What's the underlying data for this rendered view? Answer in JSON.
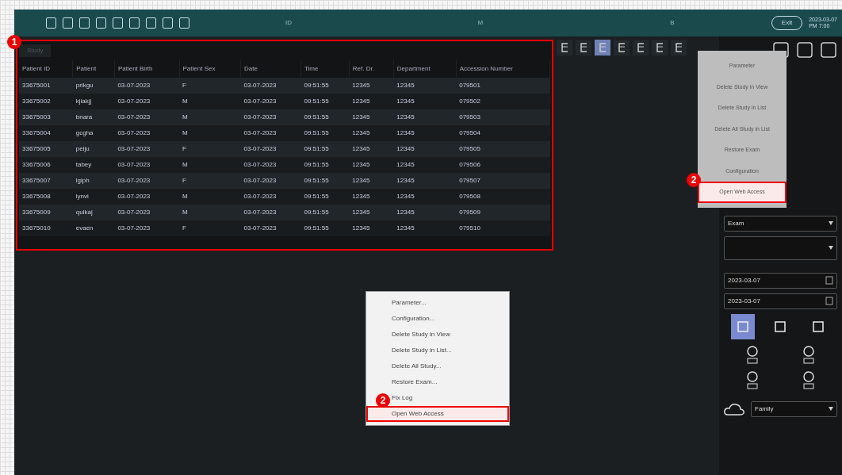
{
  "top_bar": {
    "center_labels": [
      "ID",
      "M",
      "B"
    ],
    "button": "Exit",
    "clock": [
      "2023-03-07",
      "PM 7:00"
    ]
  },
  "study_list": {
    "tab": "Study",
    "columns": [
      "Patient ID",
      "Patient",
      "Patient Birth",
      "Patient Sex",
      "Date",
      "Time",
      "Ref. Dr.",
      "Department",
      "Accession Number"
    ],
    "rows": [
      [
        "33675001",
        "prikgu",
        "03-07-2023",
        "F",
        "03-07-2023",
        "09:51:55",
        "12345",
        "12345",
        "079501"
      ],
      [
        "33675002",
        "kjiakjj",
        "03-07-2023",
        "M",
        "03-07-2023",
        "09:51:55",
        "12345",
        "12345",
        "079502"
      ],
      [
        "33675003",
        "bnara",
        "03-07-2023",
        "M",
        "03-07-2023",
        "09:51:55",
        "12345",
        "12345",
        "079503"
      ],
      [
        "33675004",
        "gcgha",
        "03-07-2023",
        "M",
        "03-07-2023",
        "09:51:55",
        "12345",
        "12345",
        "079504"
      ],
      [
        "33675005",
        "pelju",
        "03-07-2023",
        "F",
        "03-07-2023",
        "09:51:55",
        "12345",
        "12345",
        "079505"
      ],
      [
        "33675006",
        "tabey",
        "03-07-2023",
        "M",
        "03-07-2023",
        "09:51:55",
        "12345",
        "12345",
        "079506"
      ],
      [
        "33675007",
        "lgiph",
        "03-07-2023",
        "F",
        "03-07-2023",
        "09:51:55",
        "12345",
        "12345",
        "079507"
      ],
      [
        "33675008",
        "lynvi",
        "03-07-2023",
        "M",
        "03-07-2023",
        "09:51:55",
        "12345",
        "12345",
        "079508"
      ],
      [
        "33675009",
        "qulkaj",
        "03-07-2023",
        "M",
        "03-07-2023",
        "09:51:55",
        "12345",
        "12345",
        "079509"
      ],
      [
        "33675010",
        "evaen",
        "03-07-2023",
        "F",
        "03-07-2023",
        "09:51:55",
        "12345",
        "12345",
        "079510"
      ]
    ]
  },
  "view_buttons": [
    {
      "selected": false
    },
    {
      "selected": false
    },
    {
      "selected": true
    },
    {
      "selected": false
    },
    {
      "selected": false
    },
    {
      "selected": false
    },
    {
      "selected": false
    }
  ],
  "sidebar": {
    "sort_select": "Exam",
    "date_from": "2023-03-07",
    "date_to": "2023-03-07",
    "mode_buttons": [
      {
        "selected": true
      },
      {
        "selected": false
      },
      {
        "selected": false
      }
    ],
    "storage_select": "Family"
  },
  "side_menu": {
    "items": [
      {
        "label": "Parameter",
        "highlighted": false
      },
      {
        "label": "Delete Study in View",
        "highlighted": false
      },
      {
        "label": "Delete Study in List",
        "highlighted": false
      },
      {
        "label": "Delete All Study in List",
        "highlighted": false
      },
      {
        "label": "Restore Exam",
        "highlighted": false
      },
      {
        "label": "Configuration",
        "highlighted": false
      },
      {
        "label": "Open Web Access",
        "highlighted": true
      }
    ]
  },
  "context_menu": {
    "items": [
      {
        "label": "Parameter...",
        "highlighted": false
      },
      {
        "label": "Configuration...",
        "highlighted": false
      },
      {
        "label": "Delete Study in View",
        "highlighted": false
      },
      {
        "label": "Delete Study in List...",
        "highlighted": false
      },
      {
        "label": "Delete All Study...",
        "highlighted": false
      },
      {
        "label": "Restore Exam...",
        "highlighted": false
      },
      {
        "label": "Fix Log",
        "highlighted": false
      },
      {
        "label": "Open Web Access",
        "highlighted": true
      }
    ]
  },
  "callouts": [
    {
      "number": "1"
    },
    {
      "number": "2"
    },
    {
      "number": "2"
    }
  ]
}
